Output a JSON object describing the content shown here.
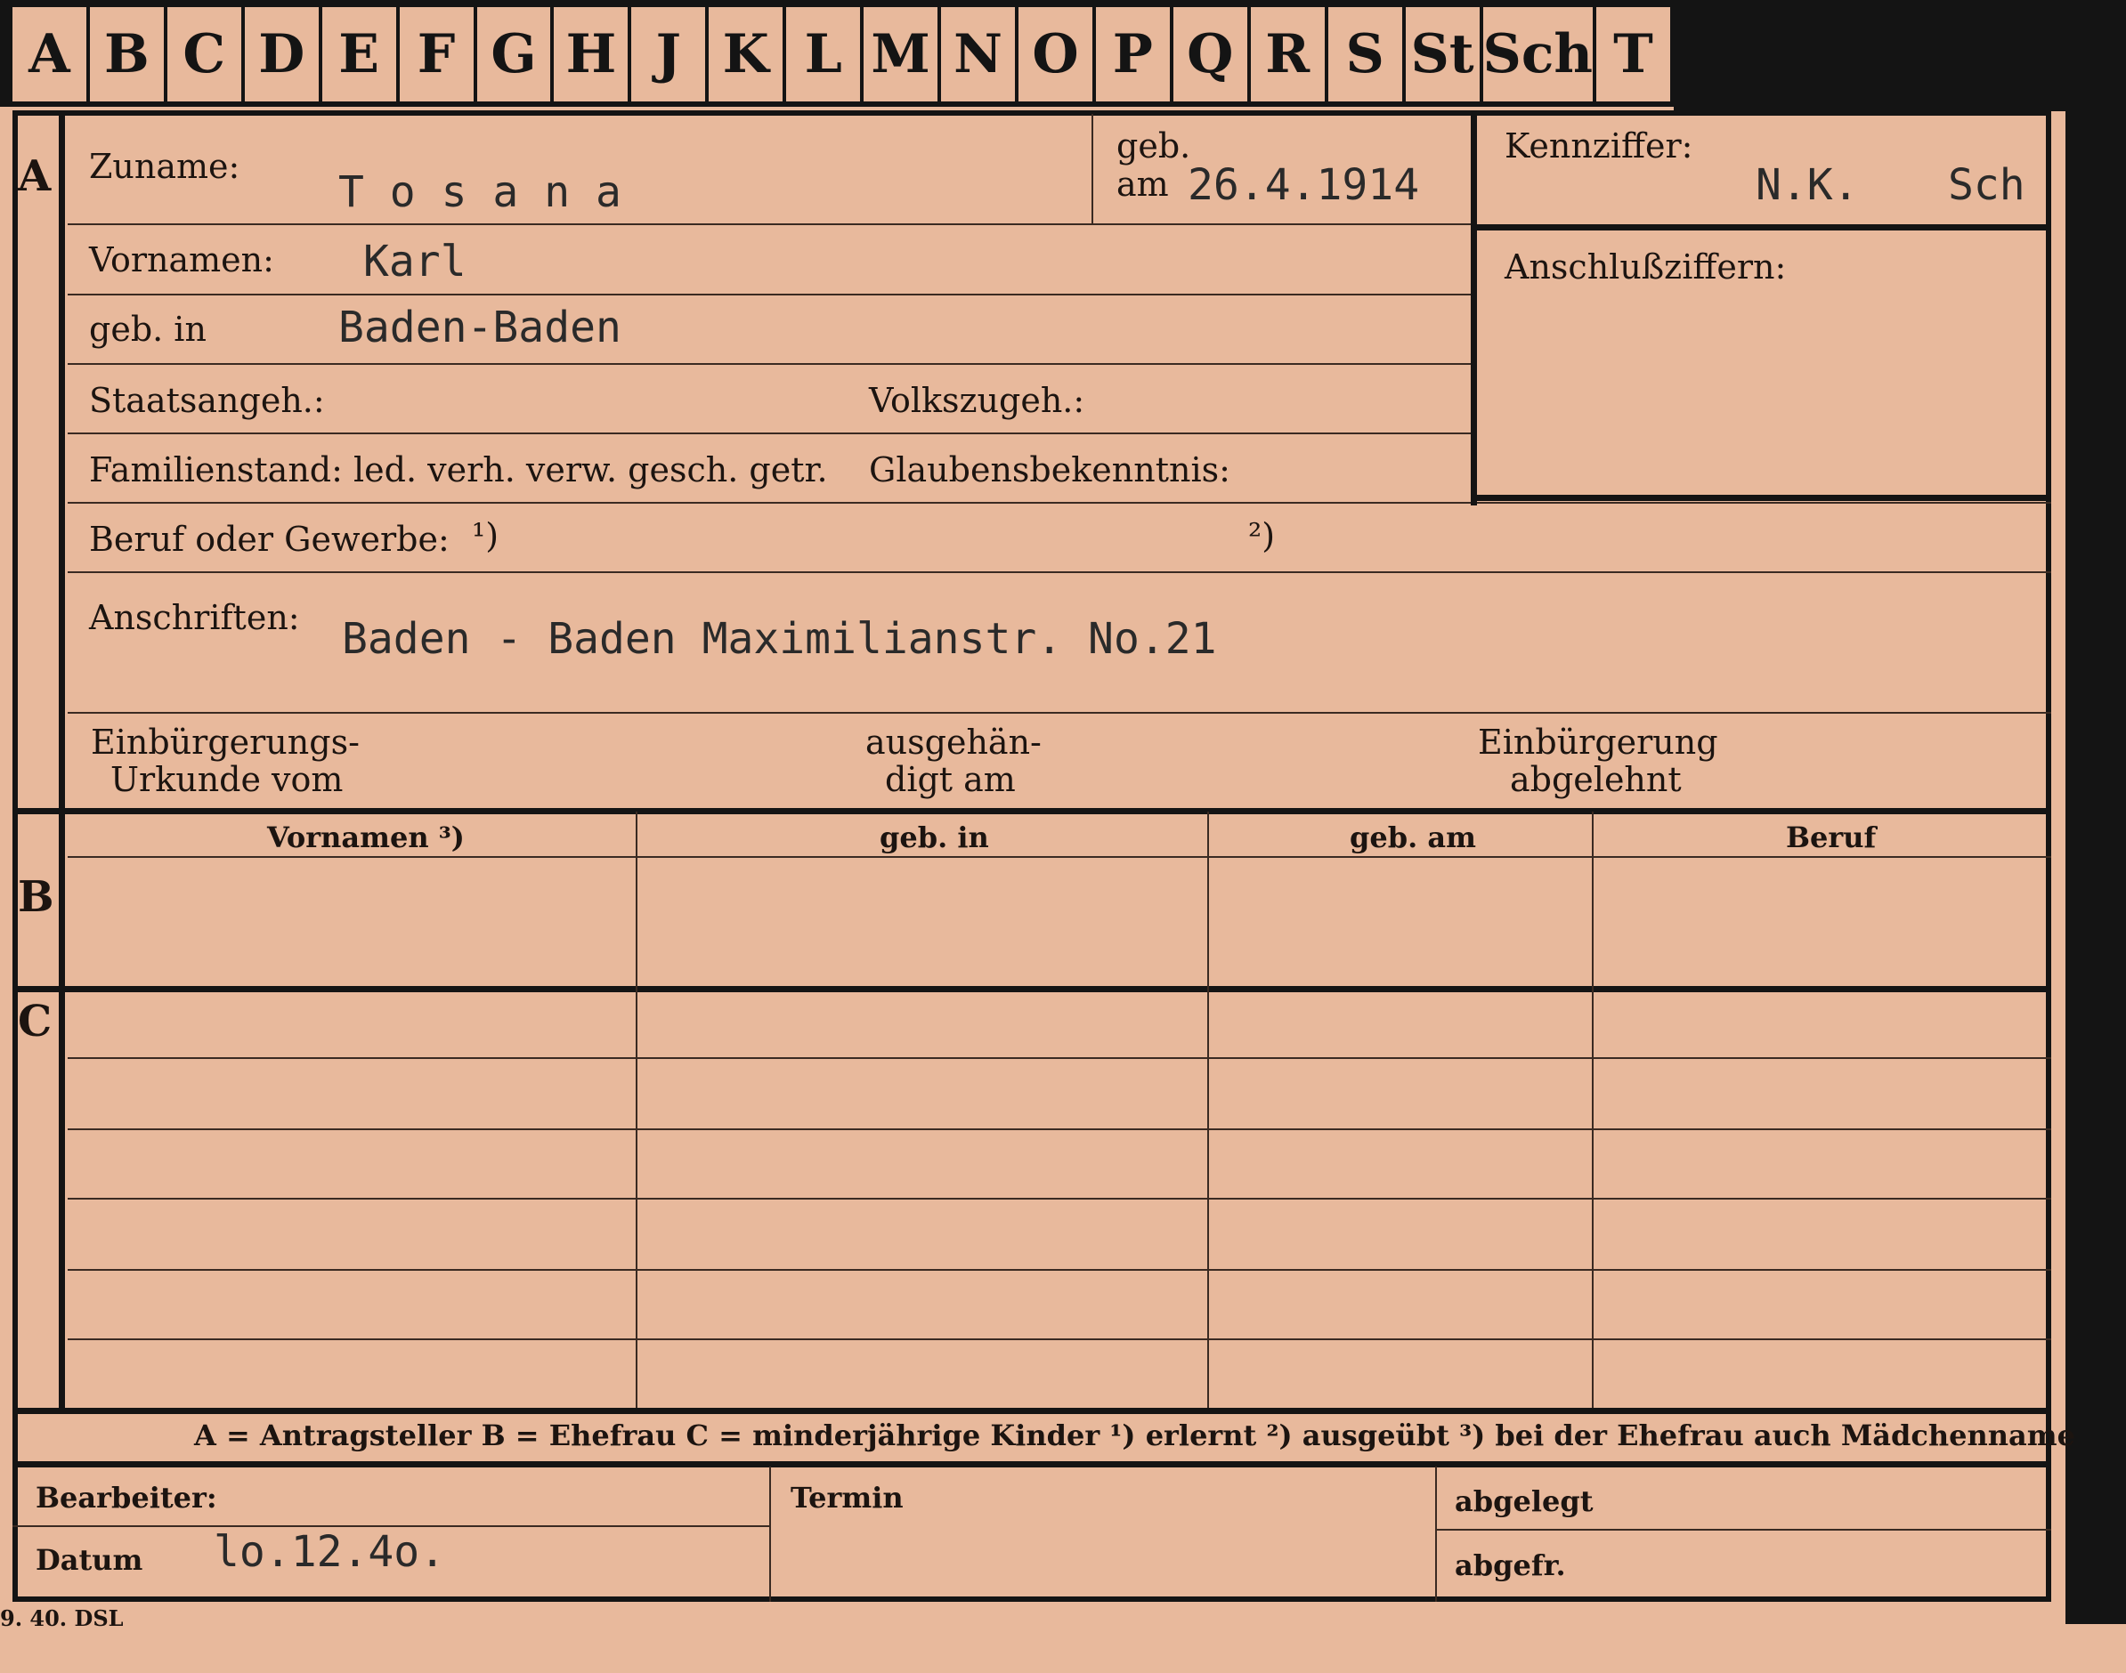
{
  "tabs": [
    "A",
    "B",
    "C",
    "D",
    "E",
    "F",
    "G",
    "H",
    "J",
    "K",
    "L",
    "M",
    "N",
    "O",
    "P",
    "Q",
    "R",
    "S",
    "St",
    "Sch",
    "T"
  ],
  "sections": {
    "a": "A",
    "b": "B",
    "c": "C"
  },
  "labels": {
    "zuname": "Zuname:",
    "geb": "geb.",
    "am": "am",
    "vornamen": "Vornamen:",
    "geb_in": "geb. in",
    "staatsangeh": "Staatsangeh.:",
    "volkszugeh": "Volkszugeh.:",
    "familienstand": "Familienstand: led. verh. verw. gesch. getr.",
    "glaubensbekenntnis": "Glaubensbekenntnis:",
    "beruf_oder_gewerbe": "Beruf oder Gewerbe:",
    "fn1": "¹)",
    "fn2": "²)",
    "anschriften": "Anschriften:",
    "einbuergerung_1": "Einbürgerungs-",
    "einbuergerung_2": "Urkunde vom",
    "ausgehaendigt_1": "ausgehän-",
    "ausgehaendigt_2": "digt am",
    "abgelehnt_1": "Einbürgerung",
    "abgelehnt_2": "abgelehnt",
    "kennziffer": "Kennziffer:",
    "anschlussziffern": "Anschlußziffern:"
  },
  "values": {
    "zuname": "T o s a n a",
    "geb_am": "26.4.1914",
    "vornamen": "Karl",
    "geb_in": "Baden-Baden",
    "anschriften": "Baden - Baden Maximilianstr. No.21",
    "kennziffer_1": "N.K.",
    "kennziffer_2": "Sch",
    "datum": "lo.12.4o."
  },
  "table_headers": [
    "Vornamen ³)",
    "geb. in",
    "geb. am",
    "Beruf"
  ],
  "legend": "A = Antragsteller   B = Ehefrau   C = minderjährige Kinder   ¹) erlernt   ²) ausgeübt   ³) bei der Ehefrau auch Mädchenname",
  "footer": {
    "bearbeiter": "Bearbeiter:",
    "datum": "Datum",
    "termin": "Termin",
    "abgelegt": "abgelegt",
    "abgefr": "abgefr."
  },
  "print_code": "9. 40. DSL"
}
